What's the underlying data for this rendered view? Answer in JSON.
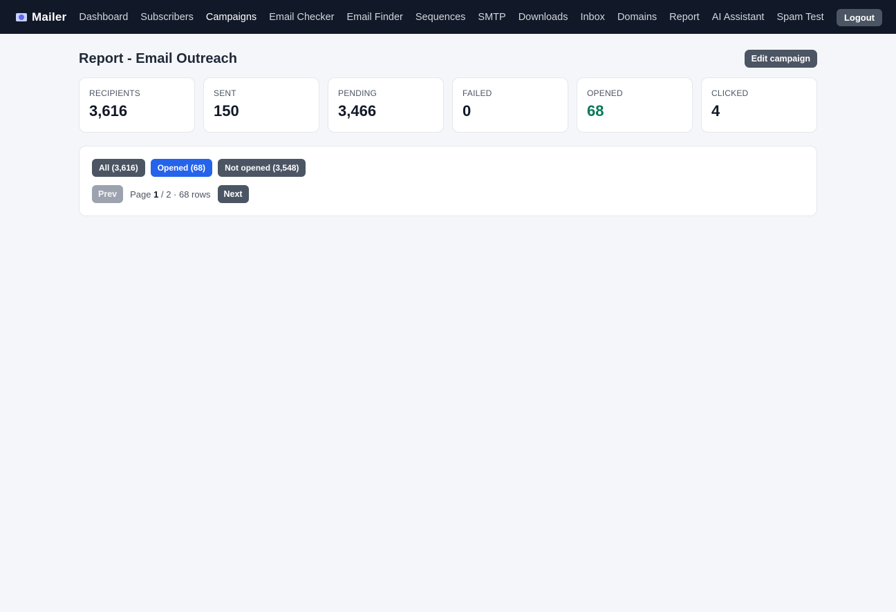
{
  "brand": {
    "label": "Mailer",
    "icon": "mail-icon"
  },
  "nav": {
    "items": [
      {
        "label": "Dashboard",
        "active": false
      },
      {
        "label": "Subscribers",
        "active": false
      },
      {
        "label": "Campaigns",
        "active": true
      },
      {
        "label": "Email Checker",
        "active": false
      },
      {
        "label": "Email Finder",
        "active": false
      },
      {
        "label": "Sequences",
        "active": false
      },
      {
        "label": "SMTP",
        "active": false
      },
      {
        "label": "Downloads",
        "active": false
      },
      {
        "label": "Inbox",
        "active": false
      },
      {
        "label": "Domains",
        "active": false
      },
      {
        "label": "Report",
        "active": false
      },
      {
        "label": "AI Assistant",
        "active": false
      },
      {
        "label": "Spam Test",
        "active": false
      }
    ],
    "logout_label": "Logout"
  },
  "page": {
    "title": "Report - Email Outreach",
    "edit_label": "Edit campaign"
  },
  "stats": [
    {
      "label": "RECIPIENTS",
      "value": "3,616"
    },
    {
      "label": "SENT",
      "value": "150"
    },
    {
      "label": "PENDING",
      "value": "3,466"
    },
    {
      "label": "FAILED",
      "value": "0"
    },
    {
      "label": "OPENED",
      "value": "68",
      "color": "#047857"
    },
    {
      "label": "CLICKED",
      "value": "4"
    }
  ],
  "filters": [
    {
      "label": "All (3,616)",
      "active": false
    },
    {
      "label": "Opened (68)",
      "active": true
    },
    {
      "label": "Not opened (3,548)",
      "active": false
    }
  ],
  "pager": {
    "prev_label": "Prev",
    "next_label": "Next",
    "page_word": "Page",
    "current": "1",
    "rest": "/ 2 · 68 rows"
  },
  "colors": {
    "topbar": "#111827",
    "accent": "#2563eb",
    "button": "#4b5563",
    "opened": "#047857"
  }
}
